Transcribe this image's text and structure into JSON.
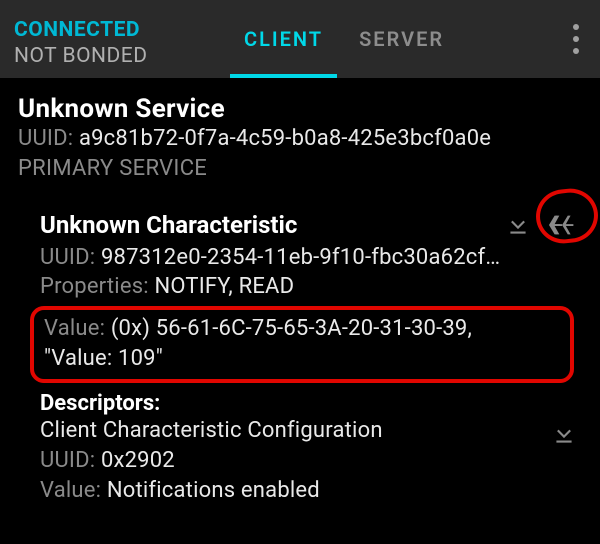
{
  "header": {
    "status_connected": "CONNECTED",
    "status_bond": "NOT BONDED",
    "tabs": {
      "client": "CLIENT",
      "server": "SERVER"
    }
  },
  "service": {
    "heading": "Unknown Service",
    "uuid_label": "UUID: ",
    "uuid_value": "a9c81b72-0f7a-4c59-b0a8-425e3bcf0a0e",
    "primary": "PRIMARY SERVICE"
  },
  "characteristic": {
    "heading": "Unknown Characteristic",
    "uuid_label": "UUID: ",
    "uuid_value": "987312e0-2354-11eb-9f10-fbc30a62cf…",
    "props_label": "Properties: ",
    "props_value": "NOTIFY, READ",
    "value_label": "Value: ",
    "value_hex": "(0x) 56-61-6C-75-65-3A-20-31-30-39,",
    "value_string": "\"Value: 109\""
  },
  "descriptor": {
    "heading": "Descriptors:",
    "name": "Client Characteristic Configuration",
    "uuid_label": "UUID: ",
    "uuid_value": "0x2902",
    "value_label": "Value: ",
    "value_value": "Notifications enabled"
  },
  "icons": {
    "download": "download-icon",
    "notify": "notify-multi-arrow-icon",
    "overflow": "overflow-menu-icon"
  }
}
